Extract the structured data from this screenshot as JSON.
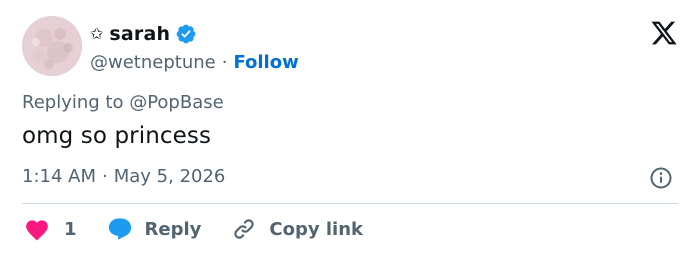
{
  "author": {
    "star": "✩",
    "display_name": "sarah",
    "handle": "@wetneptune",
    "separator": "·",
    "follow_label": "Follow"
  },
  "tweet": {
    "replying_to": "Replying to @PopBase",
    "text": "omg so princess",
    "time": "1:14 AM",
    "separator": "·",
    "date": "May 5, 2026"
  },
  "actions": {
    "like_count": "1",
    "reply_label": "Reply",
    "copy_link_label": "Copy link"
  },
  "icons": {
    "verified": "verified-badge-icon",
    "logo": "x-logo-icon",
    "info": "info-icon",
    "like": "heart-icon",
    "reply": "speech-bubble-icon",
    "copy": "link-icon"
  },
  "colors": {
    "verified_blue": "#1d9bf0",
    "follow_blue": "#006fd6",
    "heart_pink": "#f91880",
    "reply_blue": "#1d9bf0",
    "secondary_text": "#536471",
    "divider": "#cfd9de"
  }
}
